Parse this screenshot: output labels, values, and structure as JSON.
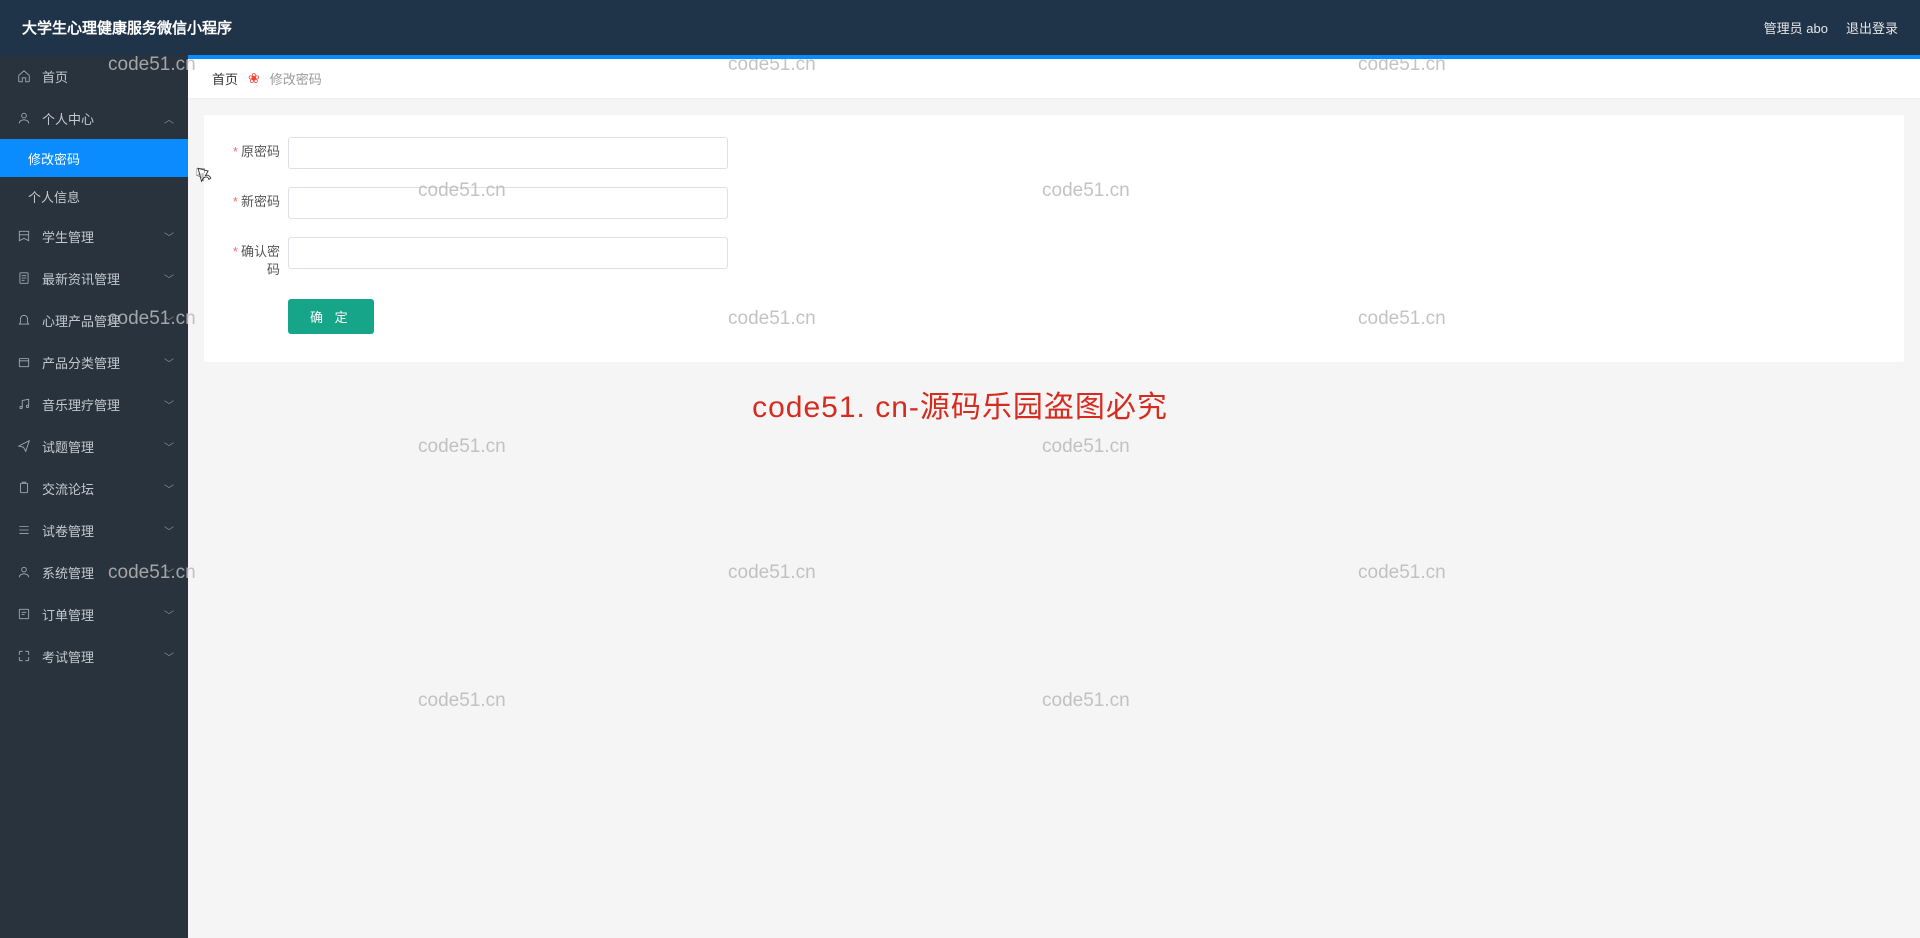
{
  "header": {
    "title": "大学生心理健康服务微信小程序",
    "admin_label": "管理员 abo",
    "logout_label": "退出登录"
  },
  "sidebar": {
    "home": "首页",
    "personal_center": "个人中心",
    "change_password": "修改密码",
    "personal_info": "个人信息",
    "student_mgmt": "学生管理",
    "news_mgmt": "最新资讯管理",
    "product_mgmt": "心理产品管理",
    "category_mgmt": "产品分类管理",
    "music_mgmt": "音乐理疗管理",
    "question_mgmt": "试题管理",
    "forum": "交流论坛",
    "exam_paper_mgmt": "试卷管理",
    "system_mgmt": "系统管理",
    "order_mgmt": "订单管理",
    "exam_mgmt": "考试管理"
  },
  "breadcrumb": {
    "home": "首页",
    "current": "修改密码"
  },
  "form": {
    "old_pwd_label": "原密码",
    "new_pwd_label": "新密码",
    "confirm_pwd_label": "确认密码",
    "submit_label": "确 定"
  },
  "watermark": {
    "text": "code51.cn",
    "banner": "code51. cn-源码乐园盗图必究"
  }
}
